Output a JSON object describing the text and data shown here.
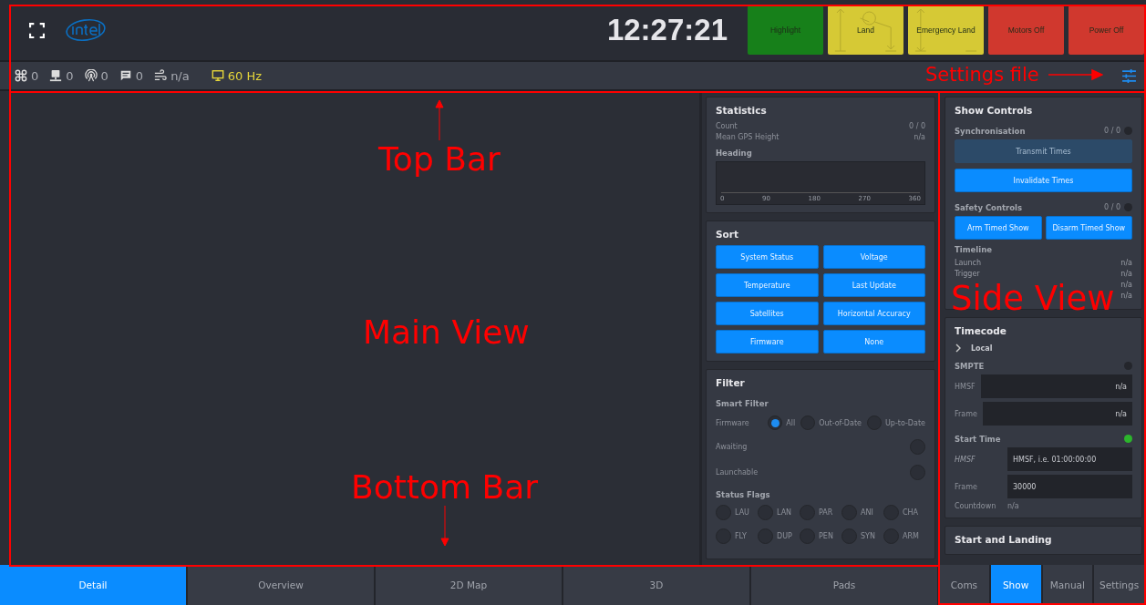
{
  "top_bar": {
    "clock": "12:27:21",
    "actions": [
      {
        "label": "Highlight",
        "color": "#17801a",
        "kind": "plain"
      },
      {
        "label": "Land",
        "color": "#d6c935",
        "kind": "land"
      },
      {
        "label": "Emergency Land",
        "color": "#d6c935",
        "kind": "descend"
      },
      {
        "label": "Motors Off",
        "color": "#d0382e",
        "kind": "plain"
      },
      {
        "label": "Power Off",
        "color": "#d0382e",
        "kind": "plain"
      }
    ]
  },
  "status_bar": {
    "items": [
      {
        "kind": "drone",
        "value": "0"
      },
      {
        "kind": "computer",
        "value": "0"
      },
      {
        "kind": "antenna",
        "value": "0"
      },
      {
        "kind": "chat",
        "value": "0"
      },
      {
        "kind": "wind",
        "value": "n/a"
      },
      {
        "kind": "display",
        "value": "60 Hz"
      }
    ]
  },
  "statistics": {
    "title": "Statistics",
    "rows": [
      {
        "label": "Count",
        "value": "0 / 0"
      },
      {
        "label": "Mean GPS Height",
        "value": "n/a"
      }
    ],
    "heading_title": "Heading",
    "heading_ticks": [
      "0",
      "90",
      "180",
      "270",
      "360"
    ]
  },
  "sort": {
    "title": "Sort",
    "buttons": [
      "System Status",
      "Voltage",
      "Temperature",
      "Last Update",
      "Satellites",
      "Horizontal Accuracy",
      "Firmware",
      "None"
    ]
  },
  "filter": {
    "title": "Filter",
    "smart_title": "Smart Filter",
    "firmware_label": "Firmware",
    "firmware_options": [
      {
        "label": "All",
        "selected": true
      },
      {
        "label": "Out-of-Date",
        "selected": false
      },
      {
        "label": "Up-to-Date",
        "selected": false
      }
    ],
    "toggles": [
      {
        "label": "Awaiting",
        "on": false
      },
      {
        "label": "Launchable",
        "on": false
      }
    ],
    "flags_title": "Status Flags",
    "flags": [
      {
        "label": "LAU",
        "on": false
      },
      {
        "label": "LAN",
        "on": false
      },
      {
        "label": "PAR",
        "on": false
      },
      {
        "label": "ANI",
        "on": false
      },
      {
        "label": "CHA",
        "on": false
      },
      {
        "label": "FLY",
        "on": false
      },
      {
        "label": "DUP",
        "on": false
      },
      {
        "label": "PEN",
        "on": false
      },
      {
        "label": "SYN",
        "on": false
      },
      {
        "label": "ARM",
        "on": false
      }
    ]
  },
  "show_controls": {
    "title": "Show Controls",
    "sync_title": "Synchronisation",
    "sync_count": "0 / 0",
    "sync_on": false,
    "transmit": {
      "label": "Transmit Times",
      "disabled": true
    },
    "invalidate": {
      "label": "Invalidate Times",
      "disabled": false
    },
    "safety_title": "Safety Controls",
    "safety_count": "0 / 0",
    "safety_on": false,
    "safety_buttons": [
      "Arm Timed Show",
      "Disarm Timed Show"
    ],
    "timeline_title": "Timeline",
    "timeline": [
      {
        "label": "Launch",
        "value": "n/a"
      },
      {
        "label": "Trigger",
        "value": "n/a"
      },
      {
        "value": "n/a"
      },
      {
        "value": "n/a"
      }
    ]
  },
  "timecode": {
    "title": "Timecode",
    "local": "Local",
    "smpte_title": "SMPTE",
    "smpte_on": false,
    "smpte_fields": [
      {
        "label": "HMSF",
        "value": "n/a"
      },
      {
        "label": "Frame",
        "value": "n/a"
      }
    ],
    "start_title": "Start Time",
    "start_on": true,
    "start_fields": [
      {
        "label": "HMSF",
        "placeholder": "HMSF, i.e. 01:00:00:00",
        "disabled": true
      },
      {
        "label": "Frame",
        "value": "30000",
        "disabled": false
      }
    ],
    "countdown_label": "Countdown",
    "countdown_value": "n/a"
  },
  "start_and_landing": {
    "title": "Start and Landing"
  },
  "main_tabs": [
    {
      "label": "Detail",
      "selected": true
    },
    {
      "label": "Overview",
      "selected": false
    },
    {
      "label": "2D Map",
      "selected": false
    },
    {
      "label": "3D",
      "selected": false
    },
    {
      "label": "Pads",
      "selected": false
    }
  ],
  "side_tabs": [
    {
      "label": "Coms",
      "selected": false
    },
    {
      "label": "Show",
      "selected": true
    },
    {
      "label": "Manual",
      "selected": false
    },
    {
      "label": "Settings",
      "selected": false
    }
  ],
  "annotations": [
    {
      "kind": "top-bar",
      "text": "Top Bar"
    },
    {
      "kind": "main-view",
      "text": "Main View"
    },
    {
      "kind": "bottom-bar",
      "text": "Bottom Bar"
    },
    {
      "kind": "side-view",
      "text": "Side View"
    },
    {
      "kind": "settings-file",
      "text": "Settings file"
    }
  ]
}
